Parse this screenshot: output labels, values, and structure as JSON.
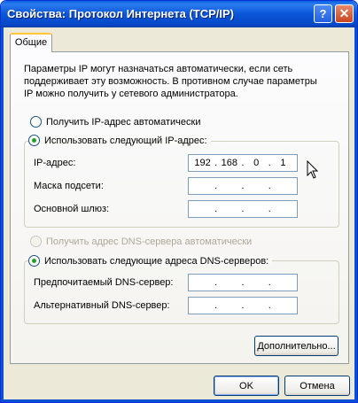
{
  "window": {
    "title": "Свойства: Протокол Интернета (TCP/IP)",
    "help_button": "?",
    "close_button": "✕"
  },
  "tabs": [
    {
      "label": "Общие",
      "active": true
    }
  ],
  "description": "Параметры IP могут назначаться автоматически, если сеть поддерживает эту возможность. В противном случае параметры IP можно получить у сетевого администратора.",
  "ip_section": {
    "auto_label": "Получить IP-адрес автоматически",
    "auto_selected": false,
    "manual_label": "Использовать следующий IP-адрес:",
    "manual_selected": true,
    "fields": {
      "ip_label": "IP-адрес:",
      "ip_octets": [
        "192",
        "168",
        "0",
        "1"
      ],
      "mask_label": "Маска подсети:",
      "mask_octets": [
        "",
        "",
        "",
        ""
      ],
      "gateway_label": "Основной шлюз:",
      "gateway_octets": [
        "",
        "",
        "",
        ""
      ]
    }
  },
  "dns_section": {
    "auto_label": "Получить адрес DNS-сервера автоматически",
    "auto_selected": false,
    "auto_disabled": true,
    "manual_label": "Использовать следующие адреса DNS-серверов:",
    "manual_selected": true,
    "fields": {
      "preferred_label": "Предпочитаемый DNS-сервер:",
      "preferred_octets": [
        "",
        "",
        "",
        ""
      ],
      "alternate_label": "Альтернативный DNS-сервер:",
      "alternate_octets": [
        "",
        "",
        "",
        ""
      ]
    }
  },
  "buttons": {
    "advanced": "Дополнительно...",
    "ok": "OK",
    "cancel": "Отмена"
  },
  "colors": {
    "titlebar": "#0a56d8",
    "dialog_bg": "#ece9d8",
    "tab_highlight": "#ffc83c",
    "radio_dot": "#21a121"
  }
}
